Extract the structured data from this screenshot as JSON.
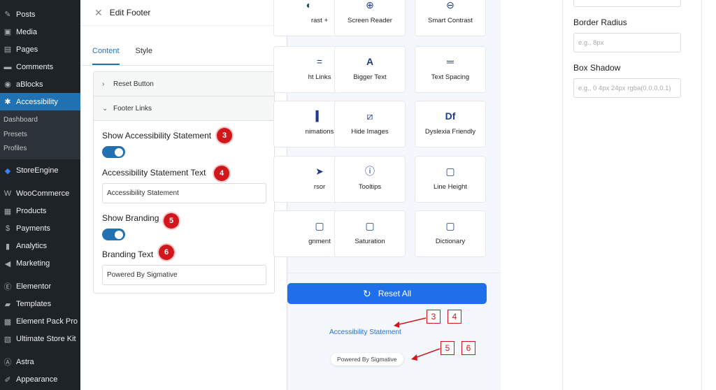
{
  "sidebar": {
    "items": [
      {
        "label": "Posts",
        "icon": "pin-icon"
      },
      {
        "label": "Media",
        "icon": "media-icon"
      },
      {
        "label": "Pages",
        "icon": "pages-icon"
      },
      {
        "label": "Comments",
        "icon": "comments-icon"
      },
      {
        "label": "aBlocks",
        "icon": "ablocks-icon"
      },
      {
        "label": "Accessibility",
        "icon": "accessibility-icon"
      }
    ],
    "sub": [
      "Dashboard",
      "Presets",
      "Profiles"
    ],
    "items2": [
      {
        "label": "StoreEngine",
        "icon": "storeengine-icon"
      },
      {
        "label": "WooCommerce",
        "icon": "woocommerce-icon"
      },
      {
        "label": "Products",
        "icon": "products-icon"
      },
      {
        "label": "Payments",
        "icon": "payments-icon"
      },
      {
        "label": "Analytics",
        "icon": "analytics-icon"
      },
      {
        "label": "Marketing",
        "icon": "marketing-icon"
      },
      {
        "label": "Elementor",
        "icon": "elementor-icon"
      },
      {
        "label": "Templates",
        "icon": "templates-icon"
      },
      {
        "label": "Element Pack Pro",
        "icon": "element-pack-icon"
      },
      {
        "label": "Ultimate Store Kit",
        "icon": "store-kit-icon"
      },
      {
        "label": "Astra",
        "icon": "astra-icon"
      },
      {
        "label": "Appearance",
        "icon": "appearance-icon"
      }
    ]
  },
  "panel": {
    "title": "Edit Footer",
    "tabs": [
      "Content",
      "Style"
    ],
    "accordion": [
      "Reset Button",
      "Footer Links"
    ],
    "show_statement_label": "Show Accessibility Statement",
    "statement_text_label": "Accessibility Statement Text",
    "statement_text_value": "Accessibility Statement",
    "show_branding_label": "Show Branding",
    "branding_text_label": "Branding Text",
    "branding_text_value": "Powered By Sigmative",
    "badges": [
      "3",
      "4",
      "5",
      "6"
    ]
  },
  "preview": {
    "cards": [
      {
        "label": "rast +",
        "icon": "contrast-icon"
      },
      {
        "label": "Screen Reader",
        "icon": "screen-reader-icon"
      },
      {
        "label": "Smart Contrast",
        "icon": "smart-contrast-icon"
      },
      {
        "label": "ht Links",
        "icon": "links-icon"
      },
      {
        "label": "Bigger Text",
        "icon": "bigger-text-icon"
      },
      {
        "label": "Text Spacing",
        "icon": "text-spacing-icon"
      },
      {
        "label": "nimations",
        "icon": "animations-icon"
      },
      {
        "label": "Hide Images",
        "icon": "hide-images-icon"
      },
      {
        "label": "Dyslexia Friendly",
        "icon": "dyslexia-icon"
      },
      {
        "label": "rsor",
        "icon": "cursor-icon"
      },
      {
        "label": "Tooltips",
        "icon": "tooltips-icon"
      },
      {
        "label": "Line Height",
        "icon": "line-height-icon"
      },
      {
        "label": "gnment",
        "icon": "alignment-icon"
      },
      {
        "label": "Saturation",
        "icon": "saturation-icon"
      },
      {
        "label": "Dictionary",
        "icon": "dictionary-icon"
      }
    ],
    "bigger_text_glyph": "A",
    "dyslexia_glyph": "Df",
    "reset_label": "Reset All",
    "statement_link": "Accessibility Statement",
    "branding": "Powered By Sigmative",
    "annotations": [
      "3",
      "4",
      "5",
      "6"
    ]
  },
  "settings": {
    "border_radius_label": "Border Radius",
    "border_radius_placeholder": "e.g., 8px",
    "box_shadow_label": "Box Shadow",
    "box_shadow_placeholder": "e.g., 0 4px 24px rgba(0,0,0,0.1)"
  }
}
